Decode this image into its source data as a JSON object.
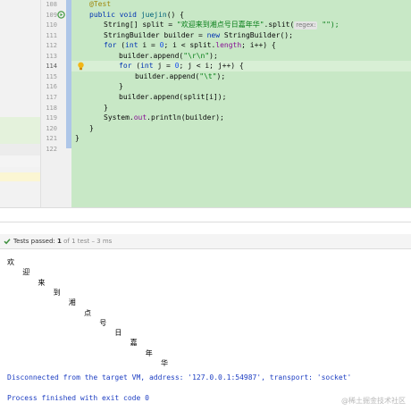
{
  "editor": {
    "lines": [
      {
        "num": "108",
        "tokens": [
          {
            "t": "@Test",
            "c": "ann"
          }
        ]
      },
      {
        "num": "109",
        "tokens": [
          {
            "t": "public ",
            "c": "kw"
          },
          {
            "t": "void ",
            "c": "kw"
          },
          {
            "t": "juejin",
            "c": "fn"
          },
          {
            "t": "() {",
            "c": "plain"
          }
        ]
      },
      {
        "num": "110",
        "tokens": [
          {
            "t": "String",
            "c": "plain"
          },
          {
            "t": "[] ",
            "c": "plain"
          },
          {
            "t": "split",
            "c": "plain"
          },
          {
            "t": " = ",
            "c": "plain"
          },
          {
            "t": "\"欢迎来到湘点号日嘉年华\"",
            "c": "str"
          },
          {
            "t": ".split(",
            "c": "plain"
          },
          {
            "t": "regex:",
            "c": "hint"
          },
          {
            "t": " \"\");",
            "c": "str"
          }
        ]
      },
      {
        "num": "111",
        "tokens": [
          {
            "t": "StringBuilder ",
            "c": "plain"
          },
          {
            "t": "builder",
            "c": "plain"
          },
          {
            "t": " = ",
            "c": "plain"
          },
          {
            "t": "new ",
            "c": "kw"
          },
          {
            "t": "StringBuilder();",
            "c": "plain"
          }
        ]
      },
      {
        "num": "112",
        "tokens": [
          {
            "t": "for ",
            "c": "kw"
          },
          {
            "t": "(",
            "c": "plain"
          },
          {
            "t": "int ",
            "c": "kw"
          },
          {
            "t": "i",
            "c": "plain"
          },
          {
            "t": " = ",
            "c": "plain"
          },
          {
            "t": "0",
            "c": "num"
          },
          {
            "t": "; i < split.",
            "c": "plain"
          },
          {
            "t": "length",
            "c": "var"
          },
          {
            "t": "; i++) {",
            "c": "plain"
          }
        ]
      },
      {
        "num": "113",
        "tokens": [
          {
            "t": "builder.append(",
            "c": "plain"
          },
          {
            "t": "\"\\r\\n\"",
            "c": "str"
          },
          {
            "t": ");",
            "c": "plain"
          }
        ]
      },
      {
        "num": "114",
        "tokens": [
          {
            "t": "for ",
            "c": "kw"
          },
          {
            "t": "(",
            "c": "plain"
          },
          {
            "t": "int ",
            "c": "kw"
          },
          {
            "t": "j",
            "c": "plain"
          },
          {
            "t": " = ",
            "c": "plain"
          },
          {
            "t": "0",
            "c": "num"
          },
          {
            "t": "; j < i; j++) {",
            "c": "plain"
          }
        ]
      },
      {
        "num": "115",
        "tokens": [
          {
            "t": "builder.append(",
            "c": "plain"
          },
          {
            "t": "\"\\t\"",
            "c": "str"
          },
          {
            "t": ");",
            "c": "plain"
          }
        ]
      },
      {
        "num": "116",
        "tokens": [
          {
            "t": "}",
            "c": "plain"
          }
        ]
      },
      {
        "num": "117",
        "tokens": [
          {
            "t": "builder.append(split[i]);",
            "c": "plain"
          }
        ]
      },
      {
        "num": "118",
        "tokens": [
          {
            "t": "}",
            "c": "plain"
          }
        ]
      },
      {
        "num": "119",
        "tokens": [
          {
            "t": "System.",
            "c": "plain"
          },
          {
            "t": "out",
            "c": "var"
          },
          {
            "t": ".println(builder);",
            "c": "plain"
          }
        ]
      },
      {
        "num": "120",
        "tokens": [
          {
            "t": "}",
            "c": "plain"
          }
        ]
      },
      {
        "num": "121",
        "tokens": [
          {
            "t": "}",
            "c": "plain"
          }
        ]
      },
      {
        "num": "122",
        "tokens": []
      }
    ],
    "current_line": "114",
    "icons": {
      "run": "run-test-icon",
      "bulb": "intention-bulb-icon"
    }
  },
  "test_bar": {
    "icon": "check-icon",
    "label": "Tests passed:",
    "count": "1",
    "detail": " of 1 test – 3 ms"
  },
  "console": {
    "output_chars": [
      "欢",
      "迎",
      "来",
      "到",
      "湘",
      "点",
      "号",
      "日",
      "嘉",
      "年",
      "华"
    ],
    "disconnected": "Disconnected from the target VM, address: '127.0.0.1:54987', transport: 'socket'",
    "finished": "Process finished with exit code 0"
  },
  "watermark": "@稀土掘金技术社区",
  "colors": {
    "code_bg": "#c8e8c6",
    "keyword": "#0033b3",
    "string": "#067d17",
    "console_blue": "#1d3ec2"
  }
}
